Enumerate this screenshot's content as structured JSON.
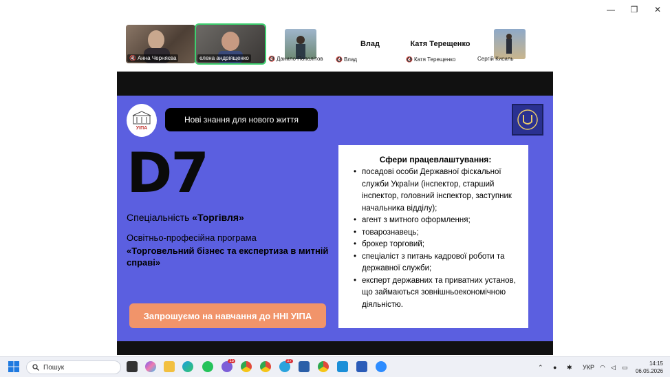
{
  "window_controls": {
    "minimize": "—",
    "restore": "❐",
    "close": "✕"
  },
  "participants": {
    "p1": "Анна Черняєва",
    "p2": "елена андріященко",
    "p3": "Данило Пополітов",
    "p4_big": "Влад",
    "p4_small": "Влад",
    "p5_big": "Катя Терещенко",
    "p5_small": "Катя Терещенко",
    "p6": "Сергій Кисиль"
  },
  "slide": {
    "logo_left_label": "УІПА",
    "pill": "Нові знання для нового життя",
    "code": "D7",
    "specialty_prefix": "Спеціальність ",
    "specialty_name": "«Торгівля»",
    "program_line": "Освітньо-професійна програма",
    "program_name": "«Торговельний бізнес та експертиза в митній справі»",
    "cta": "Запрошуємо на навчання до ННІ УІПА",
    "card_title": "Сфери працевлаштування:",
    "card_items": [
      "посадові особи Державної фіскальної служби України (інспектор, старший інспектор, головний інспектор, заступник начальника відділу);",
      "агент з митного оформлення;",
      "товарознавець;",
      "брокер торговий;",
      "спеціаліст з питань кадрової роботи та державної служби;",
      "експерт державних та приватних установ, що займаються зовнішньоекономічною діяльністю."
    ]
  },
  "taskbar": {
    "search_placeholder": "Пошук",
    "lang": "УКР",
    "time": "14:15",
    "date": "06.05.2026",
    "badge1": "15",
    "badge2": "27"
  },
  "colors": {
    "slide_bg": "#5b5fe0",
    "cta_bg": "#f1946a",
    "active_border": "#3ccf6e"
  }
}
